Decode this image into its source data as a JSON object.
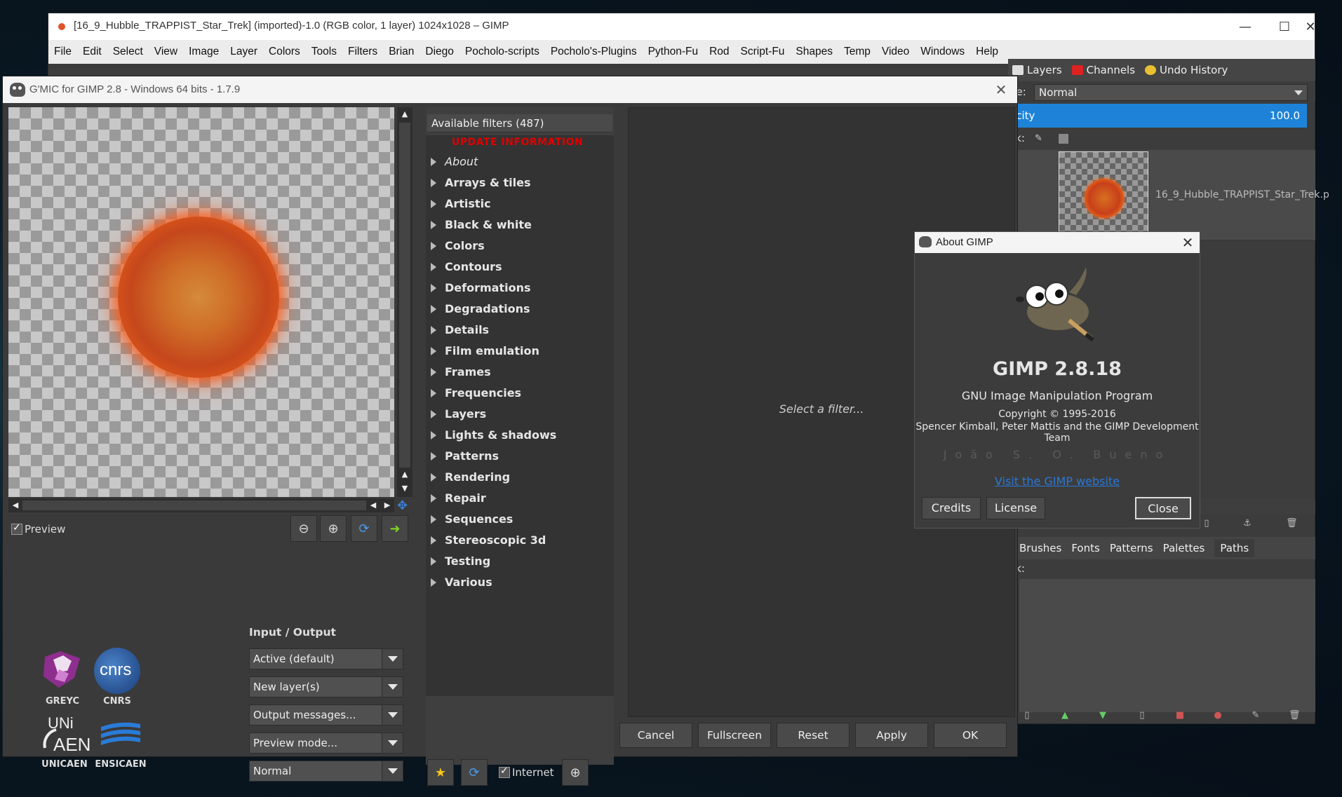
{
  "gimp": {
    "title": "[16_9_Hubble_TRAPPIST_Star_Trek] (imported)-1.0 (RGB color, 1 layer) 1024x1028 – GIMP",
    "menu": [
      "File",
      "Edit",
      "Select",
      "View",
      "Image",
      "Layer",
      "Colors",
      "Tools",
      "Filters",
      "Brian",
      "Diego",
      "Pocholo-scripts",
      "Pocholo's-Plugins",
      "Python-Fu",
      "Rod",
      "Script-Fu",
      "Shapes",
      "Temp",
      "Video",
      "Windows",
      "Help"
    ],
    "dock_tabs": [
      "Layers",
      "Channels",
      "Undo History"
    ],
    "mode_label": "de:",
    "mode_value": "Normal",
    "opacity_label": "acity",
    "opacity_value": "100.0",
    "lock_label": "ck:",
    "layer_name": "16_9_Hubble_TRAPPIST_Star_Trek.p",
    "brush_tabs": [
      "Brushes",
      "Fonts",
      "Patterns",
      "Palettes",
      "Paths"
    ],
    "paths_lock_label": "ck:"
  },
  "gmic": {
    "title": "G'MIC for GIMP 2.8 - Windows 64 bits - 1.7.9",
    "preview_label": "Preview",
    "io_title": "Input / Output",
    "io_options": [
      "Active (default)",
      "New layer(s)",
      "Output messages...",
      "Preview mode...",
      "Normal"
    ],
    "filters_header": "Available filters (487)",
    "update_info": "UPDATE INFORMATION",
    "filters": [
      "About",
      "Arrays & tiles",
      "Artistic",
      "Black & white",
      "Colors",
      "Contours",
      "Deformations",
      "Degradations",
      "Details",
      "Film emulation",
      "Frames",
      "Frequencies",
      "Layers",
      "Lights & shadows",
      "Patterns",
      "Rendering",
      "Repair",
      "Sequences",
      "Stereoscopic 3d",
      "Testing",
      "Various"
    ],
    "internet_label": "Internet",
    "select_filter": "Select a filter...",
    "buttons": {
      "cancel": "Cancel",
      "fullscreen": "Fullscreen",
      "reset": "Reset",
      "apply": "Apply",
      "ok": "OK"
    },
    "logos": {
      "greyc": "GREYC",
      "cnrs": "CNRS",
      "unicaen": "UNICAEN",
      "ensicaen": "ENSICAEN"
    }
  },
  "about": {
    "title": "About GIMP",
    "version": "GIMP 2.8.18",
    "subtitle": "GNU Image Manipulation Program",
    "copyright": "Copyright © 1995-2016",
    "authors": "Spencer Kimball, Peter Mattis and the GIMP Development Team",
    "contributor": "João S. O. Bueno",
    "link": "Visit the GIMP website",
    "buttons": {
      "credits": "Credits",
      "license": "License",
      "close": "Close"
    }
  },
  "colors": {
    "accent_blue": "#1e83d8",
    "update_red": "#e00000",
    "link_blue": "#2a78d8"
  }
}
